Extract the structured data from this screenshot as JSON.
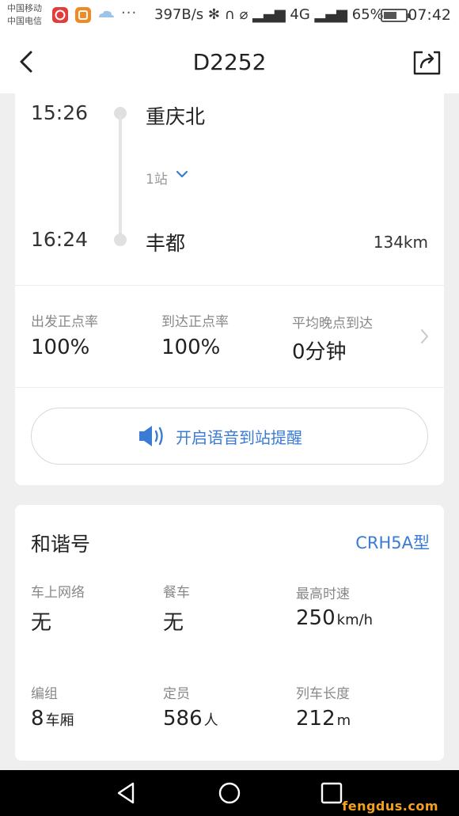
{
  "status_bar": {
    "carrier1": "中国移动",
    "carrier2": "中国电信",
    "dots": "···",
    "speed_and_icons": "397B/s  ✻ ∩ ⌀ ▂▄▆ 4G ▂▄▆ 65%",
    "time": "07:42",
    "battery_percent": 65
  },
  "header": {
    "title": "D2252",
    "back_icon": "chevron-left-icon",
    "share_icon": "share-icon"
  },
  "route": {
    "depart_time": "15:26",
    "depart_station": "重庆北",
    "stops": "1站",
    "arrive_time": "16:24",
    "arrive_station": "丰都",
    "distance": "134km"
  },
  "punctuality": {
    "depart_label": "出发正点率",
    "depart_value": "100%",
    "arrive_label": "到达正点率",
    "arrive_value": "100%",
    "delay_label": "平均晚点到达",
    "delay_value": "0分钟"
  },
  "voice_reminder": {
    "label": "开启语音到站提醒",
    "icon": "speaker-icon"
  },
  "train": {
    "name": "和谐号",
    "model": "CRH5A型",
    "specs": [
      {
        "label": "车上网络",
        "value": "无",
        "unit": ""
      },
      {
        "label": "餐车",
        "value": "无",
        "unit": ""
      },
      {
        "label": "最高时速",
        "value": "250",
        "unit": "km/h"
      },
      {
        "label": "编组",
        "value": "8",
        "unit": "车厢"
      },
      {
        "label": "定员",
        "value": "586",
        "unit": "人"
      },
      {
        "label": "列车长度",
        "value": "212",
        "unit": "m"
      }
    ]
  },
  "nav_bar": {
    "back": "triangle-back-icon",
    "home": "circle-home-icon",
    "recents": "square-recents-icon"
  },
  "watermark": "fengdus.com",
  "colors": {
    "accent": "#3a7bd5",
    "background": "#efefef",
    "card": "#ffffff"
  }
}
